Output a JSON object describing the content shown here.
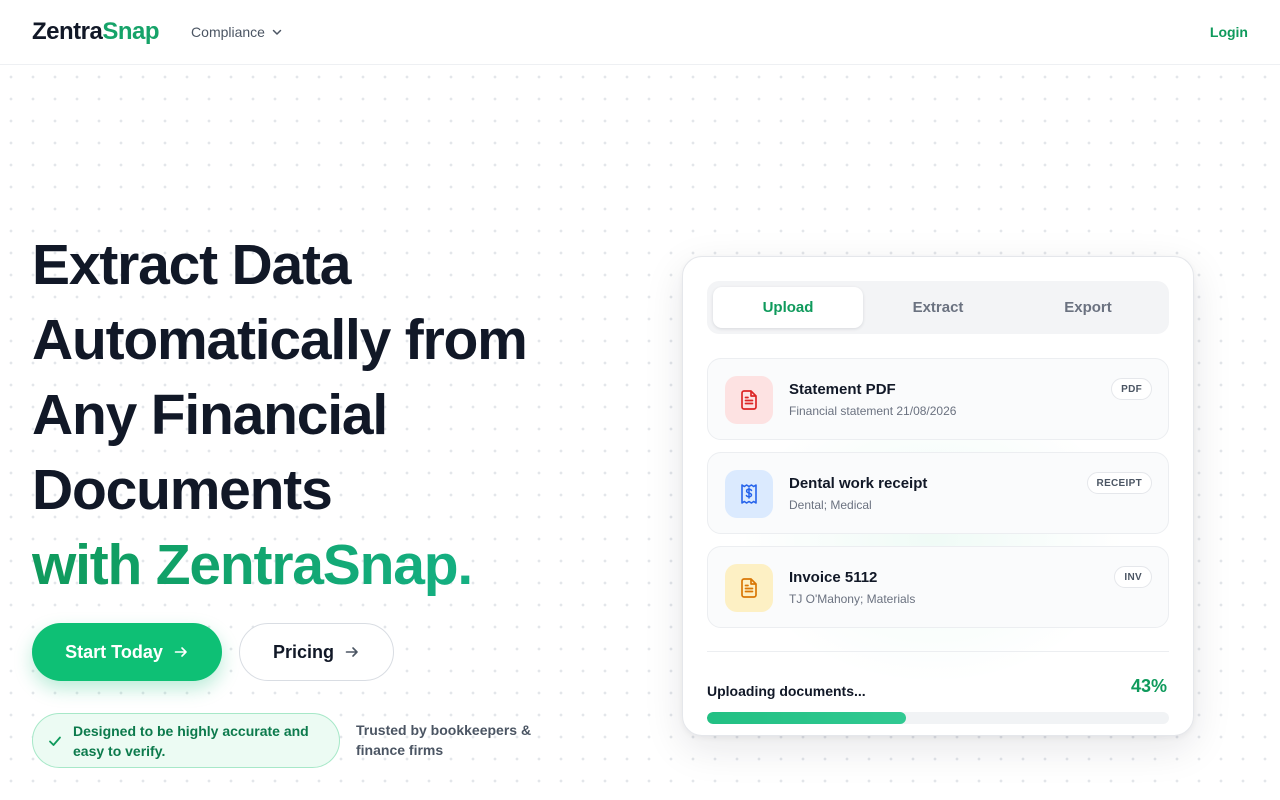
{
  "header": {
    "logo_primary": "Zentra",
    "logo_accent": "Snap",
    "nav_compliance": "Compliance",
    "login": "Login"
  },
  "hero": {
    "title_lines": [
      "Extract Data",
      "Automatically from",
      "Any Financial",
      "Documents"
    ],
    "title_highlight": "with ZentraSnap.",
    "primary_button": "Start Today",
    "secondary_button": "Pricing",
    "accuracy_badge": "Designed to be highly accurate and easy to verify.",
    "trusted_text": "Trusted by bookkeepers & finance firms"
  },
  "card": {
    "tabs": [
      {
        "label": "Upload",
        "active": true
      },
      {
        "label": "Extract",
        "active": false
      },
      {
        "label": "Export",
        "active": false
      }
    ],
    "documents": [
      {
        "name": "Statement PDF",
        "desc": "Financial statement 21/08/2026",
        "tag": "PDF",
        "icon": "file-text-icon",
        "color": "#dc2626",
        "bg": "#fde2e2"
      },
      {
        "name": "Dental work receipt",
        "desc": "Dental; Medical",
        "tag": "RECEIPT",
        "icon": "receipt-icon",
        "color": "#2563eb",
        "bg": "#dbeafe"
      },
      {
        "name": "Invoice 5112",
        "desc": "TJ O'Mahony; Materials",
        "tag": "INV",
        "icon": "file-text-icon",
        "color": "#d97706",
        "bg": "#fdf0c4"
      }
    ],
    "upload_label": "Uploading documents...",
    "upload_percent": "43%",
    "upload_progress": 0.43
  },
  "colors": {
    "brand_green": "#0f9a5c",
    "button_green": "#0ec075",
    "text_dark": "#111827"
  }
}
